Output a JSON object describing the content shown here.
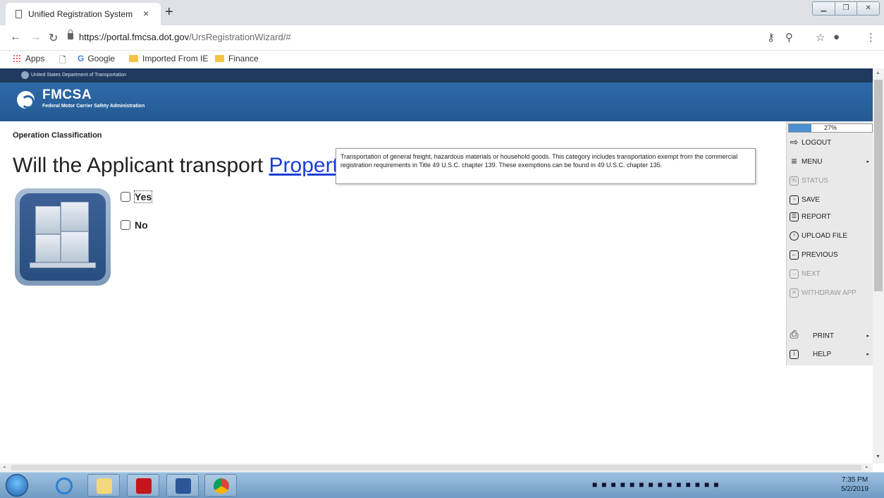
{
  "browser": {
    "tab_title": "Unified Registration System",
    "tab_close": "×",
    "new_tab": "+",
    "url_host": "https://portal.fmcsa.dot.gov",
    "url_path": "/UrsRegistrationWizard/#",
    "bookmarks": [
      "Apps",
      "Google",
      "Imported From IE",
      "Finance"
    ]
  },
  "page": {
    "agency_bar": "United States Department of Transportation",
    "logo_title": "FMCSA",
    "logo_subtitle": "Federal Motor Carrier Safety Administration",
    "section_label": "Operation Classification",
    "question_prefix": "Will the Applicant transport ",
    "question_link": "Property",
    "question_suffix": "?",
    "tooltip": "Transportation of general freight, hazardous materials or household goods. This category includes transportation exempt from the commercial registration requirements in Title 49 U.S.C. chapter 139. These exemptions can be found in 49 U.S.C. chapter 135.",
    "options": {
      "yes": "Yes",
      "no": "No"
    }
  },
  "sidemenu": {
    "progress_label": "27%",
    "progress_value": 0.27,
    "items": {
      "logout": "LOGOUT",
      "menu": "MENU",
      "status": "STATUS",
      "save": "SAVE",
      "report": "REPORT",
      "upload": "UPLOAD FILE",
      "previous": "PREVIOUS",
      "next": "NEXT",
      "withdraw": "WITHDRAW APP",
      "print": "PRINT",
      "help": "HELP"
    }
  },
  "taskbar": {
    "time": "7:35 PM",
    "date": "5/2/2019"
  },
  "colors": {
    "header": "#2f6aa8",
    "agency_bar": "#1f3a5e",
    "link": "#1a3fd6",
    "progress": "#4a8fd0"
  }
}
